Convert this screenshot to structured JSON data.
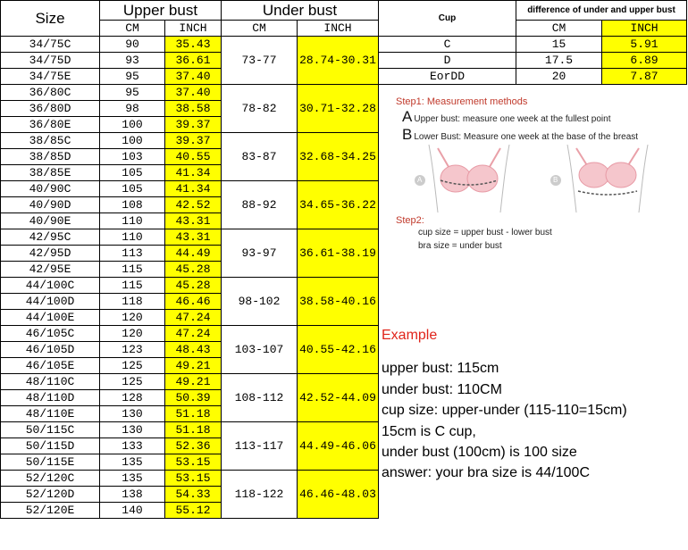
{
  "main_table": {
    "headers": {
      "size": "Size",
      "upper_bust": "Upper bust",
      "under_bust": "Under bust",
      "cm": "CM",
      "inch": "INCH"
    },
    "rows": [
      {
        "size": "34/75C",
        "upper_cm": "90",
        "upper_inch": "35.43"
      },
      {
        "size": "34/75D",
        "upper_cm": "93",
        "upper_inch": "36.61"
      },
      {
        "size": "34/75E",
        "upper_cm": "95",
        "upper_inch": "37.40"
      },
      {
        "size": "36/80C",
        "upper_cm": "95",
        "upper_inch": "37.40"
      },
      {
        "size": "36/80D",
        "upper_cm": "98",
        "upper_inch": "38.58"
      },
      {
        "size": "36/80E",
        "upper_cm": "100",
        "upper_inch": "39.37"
      },
      {
        "size": "38/85C",
        "upper_cm": "100",
        "upper_inch": "39.37"
      },
      {
        "size": "38/85D",
        "upper_cm": "103",
        "upper_inch": "40.55"
      },
      {
        "size": "38/85E",
        "upper_cm": "105",
        "upper_inch": "41.34"
      },
      {
        "size": "40/90C",
        "upper_cm": "105",
        "upper_inch": "41.34"
      },
      {
        "size": "40/90D",
        "upper_cm": "108",
        "upper_inch": "42.52"
      },
      {
        "size": "40/90E",
        "upper_cm": "110",
        "upper_inch": "43.31"
      },
      {
        "size": "42/95C",
        "upper_cm": "110",
        "upper_inch": "43.31"
      },
      {
        "size": "42/95D",
        "upper_cm": "113",
        "upper_inch": "44.49"
      },
      {
        "size": "42/95E",
        "upper_cm": "115",
        "upper_inch": "45.28"
      },
      {
        "size": "44/100C",
        "upper_cm": "115",
        "upper_inch": "45.28"
      },
      {
        "size": "44/100D",
        "upper_cm": "118",
        "upper_inch": "46.46"
      },
      {
        "size": "44/100E",
        "upper_cm": "120",
        "upper_inch": "47.24"
      },
      {
        "size": "46/105C",
        "upper_cm": "120",
        "upper_inch": "47.24"
      },
      {
        "size": "46/105D",
        "upper_cm": "123",
        "upper_inch": "48.43"
      },
      {
        "size": "46/105E",
        "upper_cm": "125",
        "upper_inch": "49.21"
      },
      {
        "size": "48/110C",
        "upper_cm": "125",
        "upper_inch": "49.21"
      },
      {
        "size": "48/110D",
        "upper_cm": "128",
        "upper_inch": "50.39"
      },
      {
        "size": "48/110E",
        "upper_cm": "130",
        "upper_inch": "51.18"
      },
      {
        "size": "50/115C",
        "upper_cm": "130",
        "upper_inch": "51.18"
      },
      {
        "size": "50/115D",
        "upper_cm": "133",
        "upper_inch": "52.36"
      },
      {
        "size": "50/115E",
        "upper_cm": "135",
        "upper_inch": "53.15"
      },
      {
        "size": "52/120C",
        "upper_cm": "135",
        "upper_inch": "53.15"
      },
      {
        "size": "52/120D",
        "upper_cm": "138",
        "upper_inch": "54.33"
      },
      {
        "size": "52/120E",
        "upper_cm": "140",
        "upper_inch": "55.12"
      }
    ],
    "under_groups": [
      {
        "cm": "73-77",
        "inch": "28.74-30.31"
      },
      {
        "cm": "78-82",
        "inch": "30.71-32.28"
      },
      {
        "cm": "83-87",
        "inch": "32.68-34.25"
      },
      {
        "cm": "88-92",
        "inch": "34.65-36.22"
      },
      {
        "cm": "93-97",
        "inch": "36.61-38.19"
      },
      {
        "cm": "98-102",
        "inch": "38.58-40.16"
      },
      {
        "cm": "103-107",
        "inch": "40.55-42.16"
      },
      {
        "cm": "108-112",
        "inch": "42.52-44.09"
      },
      {
        "cm": "113-117",
        "inch": "44.49-46.06"
      },
      {
        "cm": "118-122",
        "inch": "46.46-48.03"
      }
    ]
  },
  "cup_table": {
    "cup_header": "Cup",
    "diff_header": "difference of under and upper bust",
    "cm": "CM",
    "inch": "INCH",
    "rows": [
      {
        "cup": "C",
        "cm": "15",
        "inch": "5.91"
      },
      {
        "cup": "D",
        "cm": "17.5",
        "inch": "6.89"
      },
      {
        "cup": "EorDD",
        "cm": "20",
        "inch": "7.87"
      }
    ]
  },
  "guide": {
    "step1": "Step1:  Measurement methods",
    "a_letter": "A",
    "a_text": "Upper bust: measure one week at the fullest point",
    "b_letter": "B",
    "b_text": "Lower Bust: Measure one week at the base of the breast",
    "fig_a": "A",
    "fig_b": "B",
    "step2": "Step2:",
    "formula1": "cup size = upper bust - lower bust",
    "formula2": "bra size = under bust"
  },
  "example": {
    "title": "Example",
    "lines": [
      "upper bust:   115cm",
      "under bust:   110CM",
      "cup size:  upper-under (115-110=15cm)",
      "15cm is  C cup,",
      "under bust (100cm) is 100 size",
      "answer:  your bra size is 44/100C"
    ]
  }
}
